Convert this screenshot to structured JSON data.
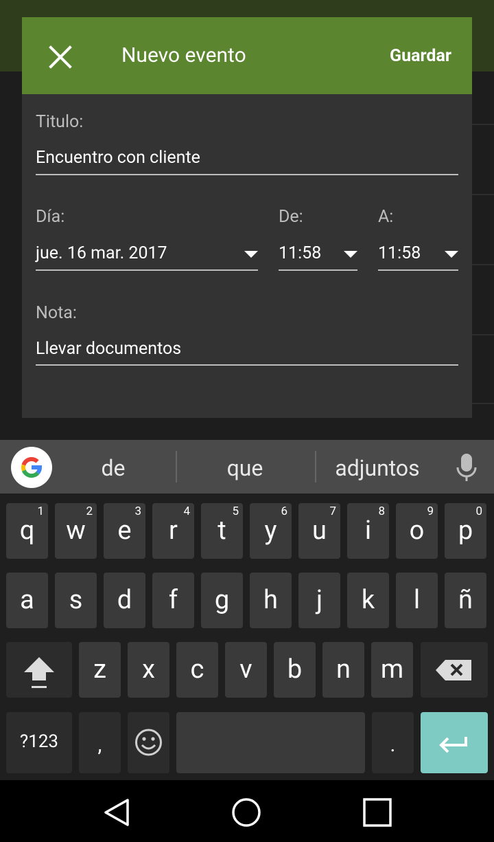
{
  "dialog": {
    "title": "Nuevo evento",
    "save_label": "Guardar",
    "title_label": "Titulo:",
    "title_value": "Encuentro con cliente",
    "day_label": "Día:",
    "day_value": "jue. 16 mar. 2017",
    "from_label": "De:",
    "from_value": "11:58",
    "to_label": "A:",
    "to_value": "11:58",
    "note_label": "Nota:",
    "note_value": "Llevar documentos"
  },
  "suggestions": [
    "de",
    "que",
    "adjuntos"
  ],
  "keyboard": {
    "row1": [
      {
        "k": "q",
        "n": "1"
      },
      {
        "k": "w",
        "n": "2"
      },
      {
        "k": "e",
        "n": "3"
      },
      {
        "k": "r",
        "n": "4"
      },
      {
        "k": "t",
        "n": "5"
      },
      {
        "k": "y",
        "n": "6"
      },
      {
        "k": "u",
        "n": "7"
      },
      {
        "k": "i",
        "n": "8"
      },
      {
        "k": "o",
        "n": "9"
      },
      {
        "k": "p",
        "n": "0"
      }
    ],
    "row2": [
      "a",
      "s",
      "d",
      "f",
      "g",
      "h",
      "j",
      "k",
      "l",
      "ñ"
    ],
    "row3": [
      "z",
      "x",
      "c",
      "v",
      "b",
      "n",
      "m"
    ],
    "symbols_label": "?123",
    "comma": ",",
    "period": "."
  },
  "colors": {
    "accent_green": "#5b852f",
    "enter_key": "#7ecbc3"
  },
  "icons": [
    "close-icon",
    "dropdown-caret-icon",
    "google-icon",
    "mic-icon",
    "shift-icon",
    "backspace-icon",
    "emoji-icon",
    "enter-icon",
    "back-icon",
    "home-icon",
    "recents-icon"
  ]
}
